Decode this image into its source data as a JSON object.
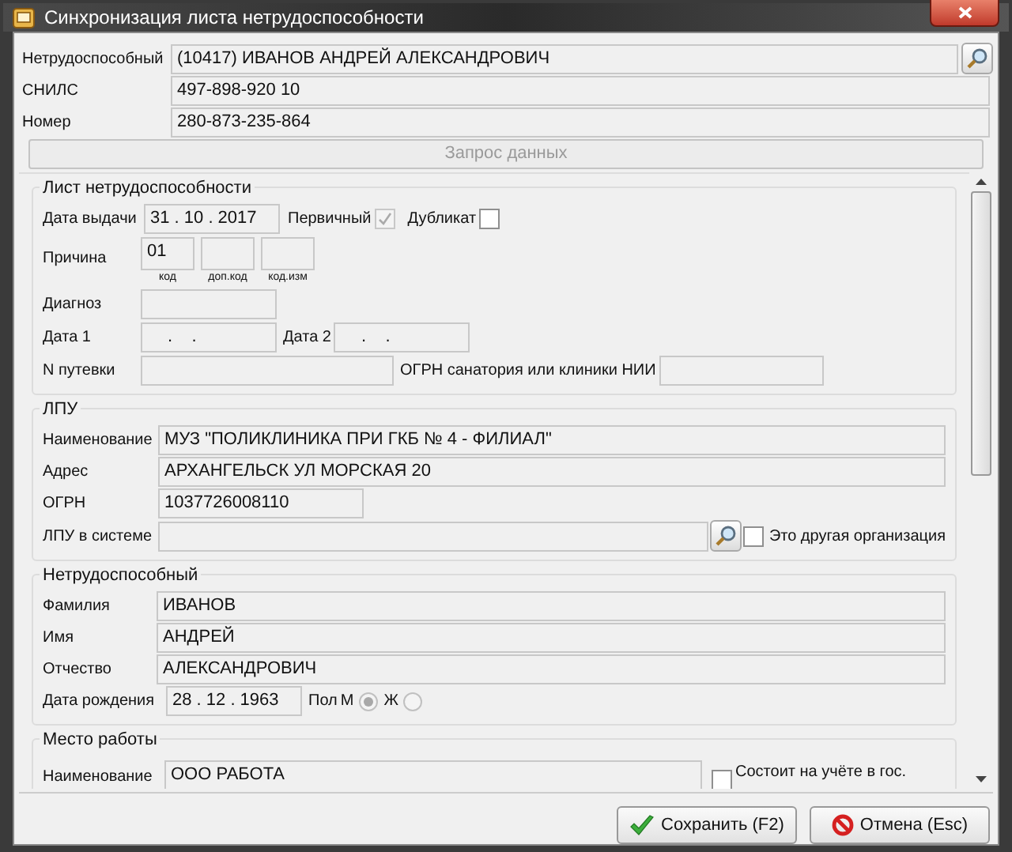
{
  "window": {
    "title": "Синхронизация листа нетрудоспособности"
  },
  "header_fields": [
    {
      "label": "Нетрудоспособный",
      "value": "(10417) ИВАНОВ АНДРЕЙ АЛЕКСАНДРОВИЧ",
      "kind": "search"
    },
    {
      "label": "СНИЛС",
      "value": "497-898-920 10",
      "kind": "plain"
    },
    {
      "label": "Номер",
      "value": "280-873-235-864",
      "kind": "plain"
    }
  ],
  "request_button": {
    "label": "Запрос данных",
    "disabled": true
  },
  "sick_leave": {
    "title": "Лист нетрудоспособности",
    "issue_date": {
      "label": "Дата выдачи",
      "value": "31 . 10 . 2017"
    },
    "primary": {
      "label": "Первичный",
      "checked": true,
      "disabled": true
    },
    "duplicate": {
      "label": "Дубликат",
      "checked": false,
      "disabled": false
    },
    "reason": {
      "label": "Причина",
      "codes": [
        {
          "value": "01",
          "caption": "код"
        },
        {
          "caption": "доп.код"
        },
        {
          "caption": "код.изм"
        }
      ]
    },
    "diagnosis": {
      "label": "Диагноз"
    },
    "date_1": {
      "label": "Дата 1",
      "value": ".    ."
    },
    "date_2": {
      "label": "Дата 2",
      "value": ".    ."
    },
    "voucher": {
      "label": "N путевки"
    },
    "sanatorium_ogrn": {
      "label": "ОГРН санатория или клиники НИИ"
    }
  },
  "lpu": {
    "title": "ЛПУ",
    "fields": [
      {
        "label": "Наименование",
        "value": "МУЗ \"ПОЛИКЛИНИКА ПРИ ГКБ № 4 - ФИЛИАЛ\"",
        "kind": "wide"
      },
      {
        "label": "Адрес",
        "value": "АРХАНГЕЛЬСК УЛ МОРСКАЯ 20",
        "kind": "wide"
      },
      {
        "label": "ОГРН",
        "value": "1037726008110",
        "kind": "short"
      }
    ],
    "in_system": {
      "label": "ЛПУ в системе"
    },
    "other_org": {
      "label": "Это другая организация",
      "checked": false
    }
  },
  "patient": {
    "title": "Нетрудоспособный",
    "fields": [
      {
        "label": "Фамилия",
        "value": "ИВАНОВ"
      },
      {
        "label": "Имя",
        "value": "АНДРЕЙ"
      },
      {
        "label": "Отчество",
        "value": "АЛЕКСАНДРОВИЧ"
      }
    ],
    "birth_date": {
      "label": "Дата рождения",
      "value": "28 . 12 . 1963"
    },
    "sex": {
      "label": "Пол",
      "options": [
        {
          "label": "М",
          "selected": true
        },
        {
          "label": "Ж",
          "selected": false
        }
      ]
    }
  },
  "workplace": {
    "title": "Место работы",
    "name": {
      "label": "Наименование",
      "value": "ООО РАБОТА"
    },
    "registered": {
      "label": "Состоит на учёте в гос.",
      "checked": false
    }
  },
  "buttons": [
    {
      "label": "Сохранить (F2)",
      "kind": "save"
    },
    {
      "label": "Отмена (Esc)",
      "kind": "cancel"
    }
  ]
}
